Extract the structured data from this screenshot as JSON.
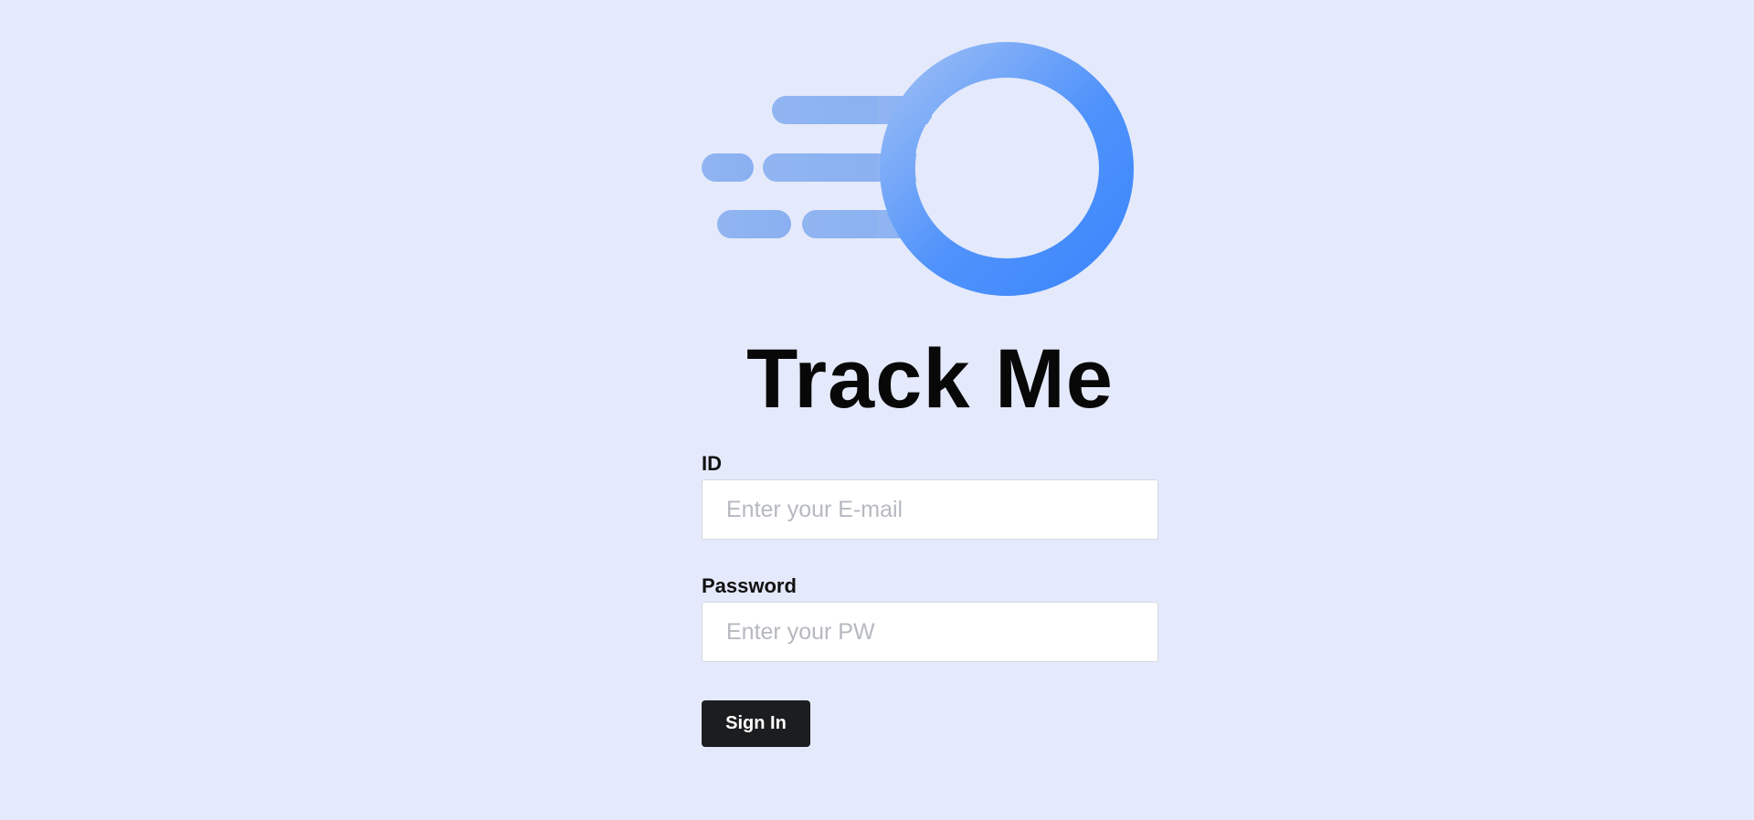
{
  "app": {
    "title": "Track Me"
  },
  "logo": {
    "icon": "motion-circle-logo-icon",
    "gradient_start": "#9dbcf3",
    "gradient_end": "#3d88fd",
    "streak_color": "#8db3f2"
  },
  "form": {
    "id_label": "ID",
    "id_placeholder": "Enter your E-mail",
    "id_value": "",
    "password_label": "Password",
    "password_placeholder": "Enter your PW",
    "password_value": "",
    "submit_label": "Sign In"
  },
  "colors": {
    "background": "#e4eafb",
    "button": "#1c1d1f",
    "button_text": "#ffffff"
  }
}
